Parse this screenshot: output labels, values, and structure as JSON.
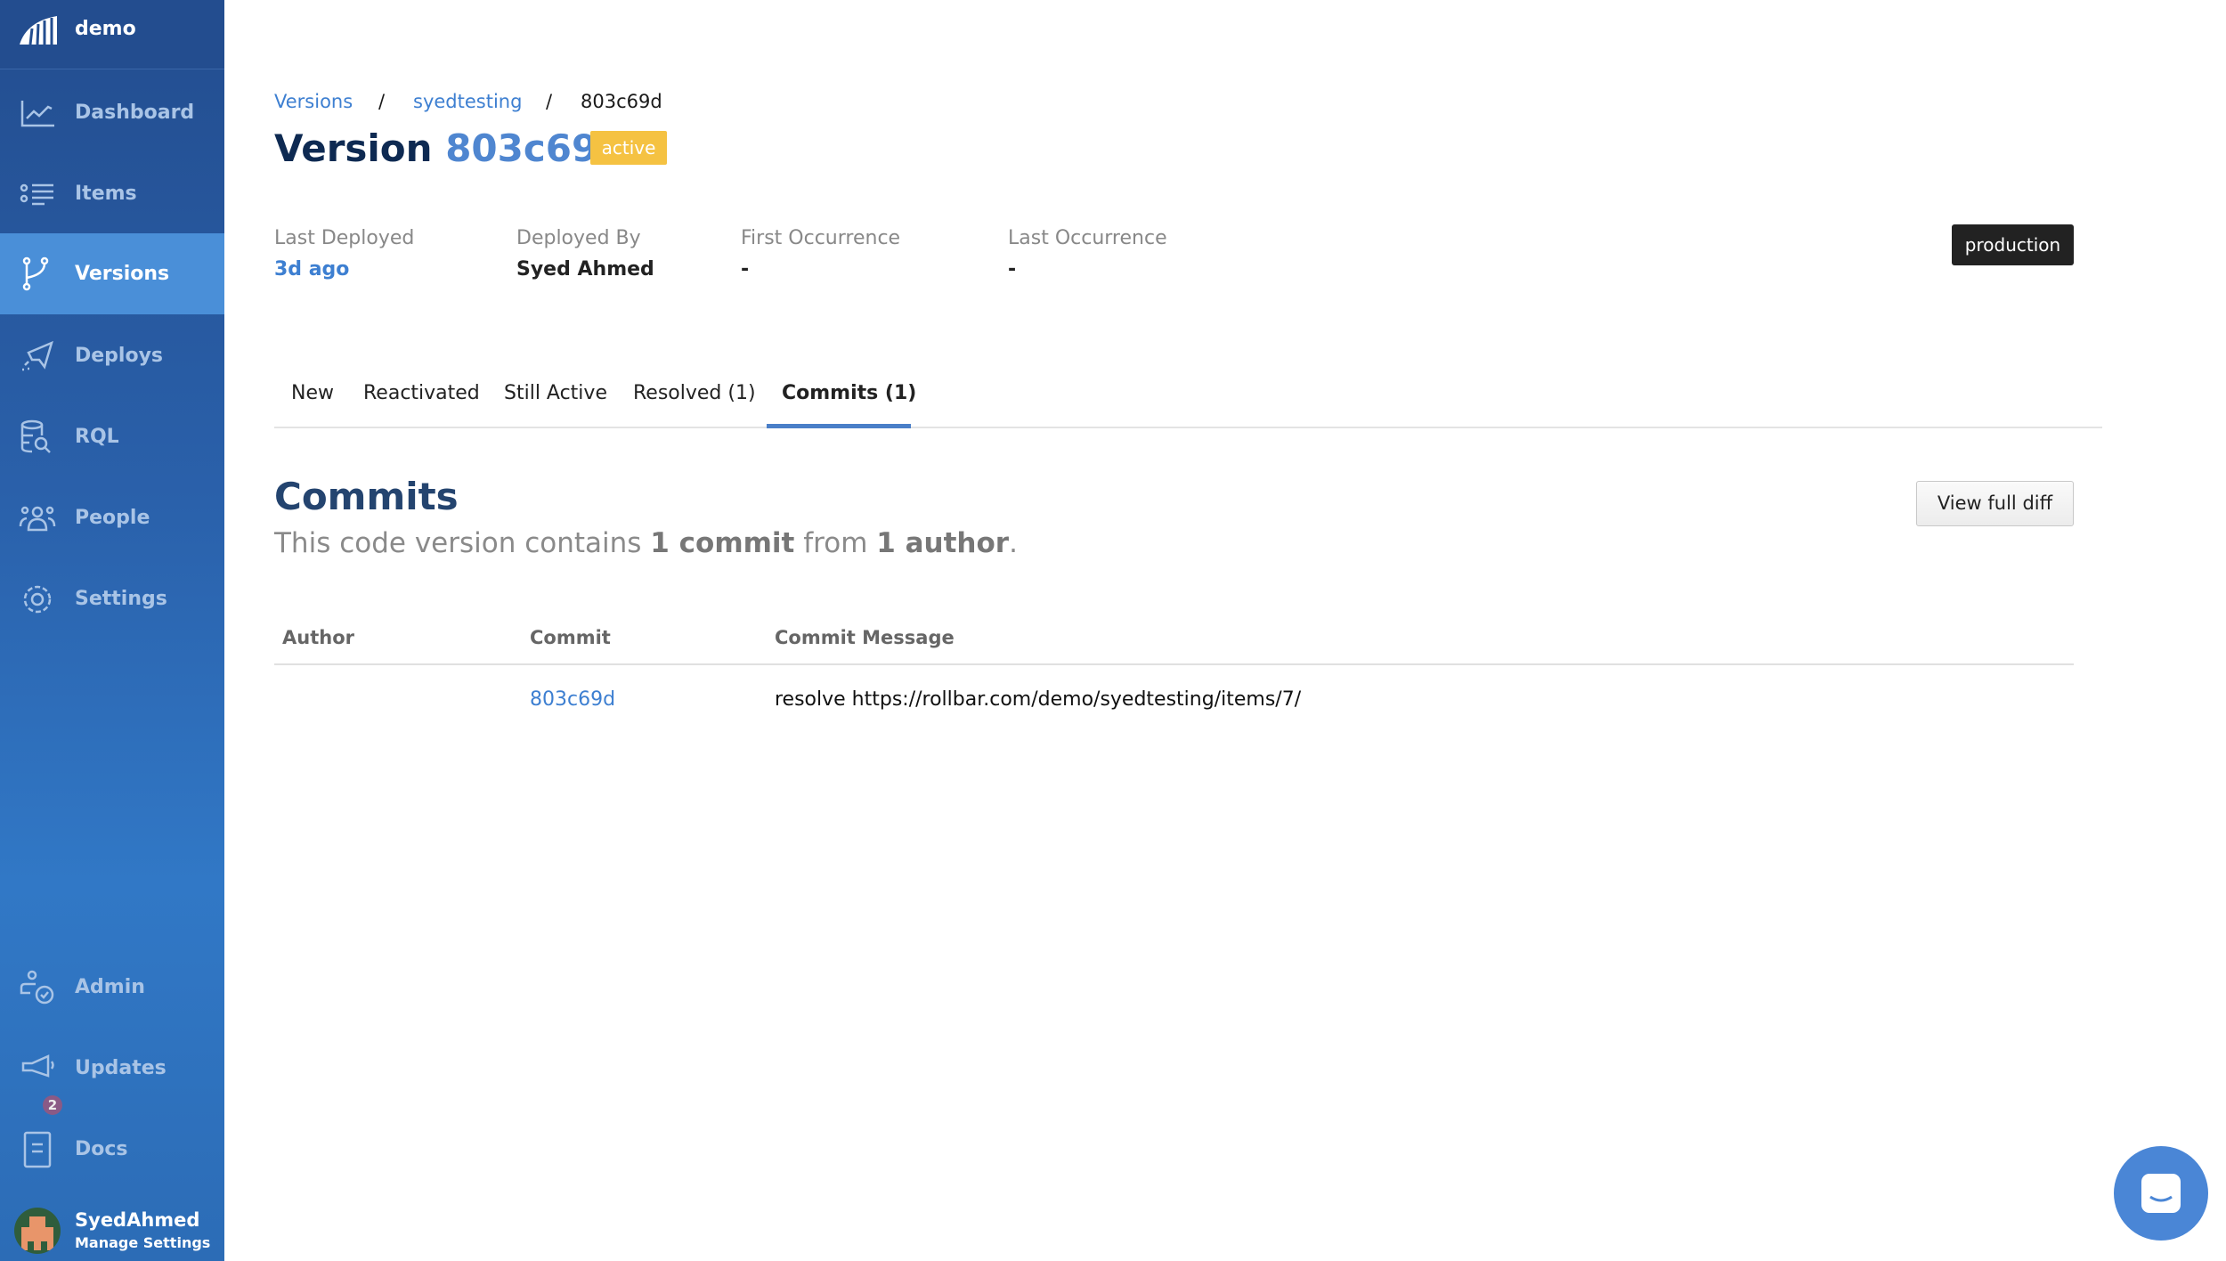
{
  "sidebar": {
    "org": "demo",
    "items": [
      {
        "label": "Dashboard",
        "icon": "chart-line-icon"
      },
      {
        "label": "Items",
        "icon": "list-icon"
      },
      {
        "label": "Versions",
        "icon": "branch-icon",
        "active": true
      },
      {
        "label": "Deploys",
        "icon": "rocket-icon"
      },
      {
        "label": "RQL",
        "icon": "database-search-icon"
      },
      {
        "label": "People",
        "icon": "people-icon"
      },
      {
        "label": "Settings",
        "icon": "gear-icon"
      }
    ],
    "bottom": [
      {
        "label": "Admin",
        "icon": "admin-icon"
      },
      {
        "label": "Updates",
        "icon": "megaphone-icon",
        "badge": "2"
      },
      {
        "label": "Docs",
        "icon": "book-icon"
      }
    ],
    "user": {
      "name": "SyedAhmed",
      "sub": "Manage Settings"
    }
  },
  "breadcrumb": [
    "Versions",
    "syedtesting",
    "803c69d"
  ],
  "breadcrumb_sep": "/",
  "title": {
    "prefix": "Version",
    "hash": "803c69d",
    "status": "active"
  },
  "meta": [
    {
      "label": "Last Deployed",
      "value": "3d ago"
    },
    {
      "label": "Deployed By",
      "value": "Syed Ahmed"
    },
    {
      "label": "First Occurrence",
      "value": "-"
    },
    {
      "label": "Last Occurrence",
      "value": "-"
    }
  ],
  "environment": "production",
  "tabs": [
    "New",
    "Reactivated",
    "Still Active",
    "Resolved (1)",
    "Commits (1)"
  ],
  "commits": {
    "heading": "Commits",
    "sub_a": "This code version contains ",
    "sub_b": "1 commit",
    "sub_c": " from ",
    "sub_d": "1 author",
    "sub_e": ".",
    "view_diff": "View full diff",
    "columns": [
      "Author",
      "Commit",
      "Commit Message"
    ],
    "rows": [
      {
        "author": "",
        "commit": "803c69d",
        "message": "resolve https://rollbar.com/demo/syedtesting/items/7/"
      }
    ]
  },
  "colors": {
    "accent": "#4a8fd8",
    "active_badge": "#f5c242",
    "title": "#0e2a52"
  }
}
